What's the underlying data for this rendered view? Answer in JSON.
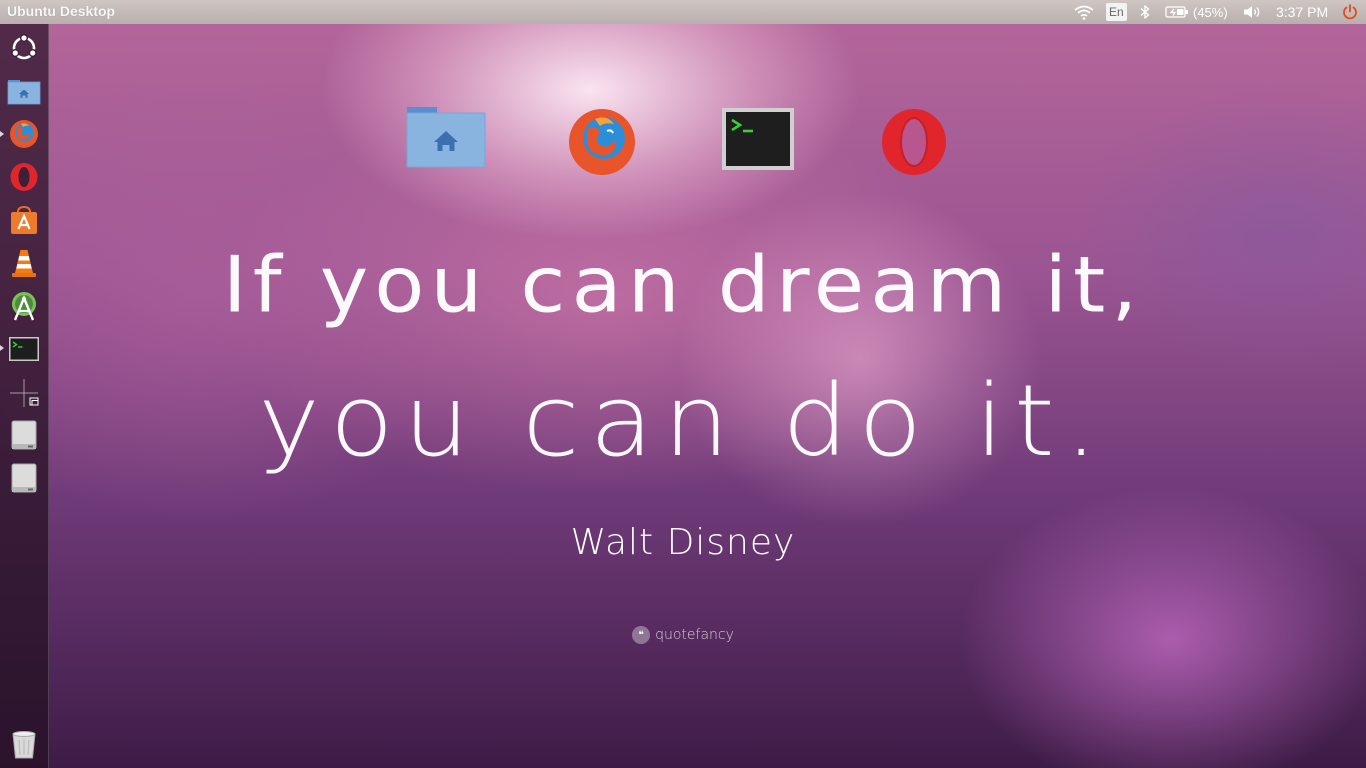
{
  "top_panel": {
    "title": "Ubuntu Desktop",
    "keyboard_layout": "En",
    "battery_percent": "(45%)",
    "clock": "3:37 PM",
    "icons": [
      "wifi-icon",
      "keyboard-layout-indicator",
      "bluetooth-icon",
      "battery-icon",
      "volume-icon",
      "power-icon"
    ]
  },
  "launcher": {
    "items": [
      {
        "name": "dash-home",
        "icon": "ubuntu-logo-icon",
        "running": false
      },
      {
        "name": "files",
        "icon": "home-folder-icon",
        "running": false
      },
      {
        "name": "firefox",
        "icon": "firefox-icon",
        "running": true
      },
      {
        "name": "opera",
        "icon": "opera-icon",
        "running": false
      },
      {
        "name": "software-center",
        "icon": "software-center-icon",
        "running": false
      },
      {
        "name": "vlc",
        "icon": "vlc-icon",
        "running": false
      },
      {
        "name": "android-studio",
        "icon": "android-studio-icon",
        "running": false
      },
      {
        "name": "terminal",
        "icon": "terminal-icon",
        "running": true
      },
      {
        "name": "workspace-switcher",
        "icon": "workspace-switcher-icon",
        "running": false
      },
      {
        "name": "drive-1",
        "icon": "drive-icon",
        "running": false
      },
      {
        "name": "drive-2",
        "icon": "drive-icon",
        "running": false
      },
      {
        "name": "trash",
        "icon": "trash-icon",
        "running": false
      }
    ]
  },
  "desktop": {
    "icons": [
      "home-folder-icon",
      "firefox-icon",
      "terminal-icon",
      "opera-icon"
    ],
    "quote_line1": "If you can dream it,",
    "quote_line2": "you can do it.",
    "author": "Walt Disney",
    "watermark": "quotefancy"
  },
  "colors": {
    "panel": "#bfb6b3",
    "launcher": "#3c1e37",
    "firefox_orange": "#e8552b",
    "firefox_blue": "#2a8fd8",
    "opera_red": "#e0262c",
    "folder_blue": "#8ab4e0",
    "terminal_green": "#35d135",
    "power_red": "#e24b1f"
  }
}
